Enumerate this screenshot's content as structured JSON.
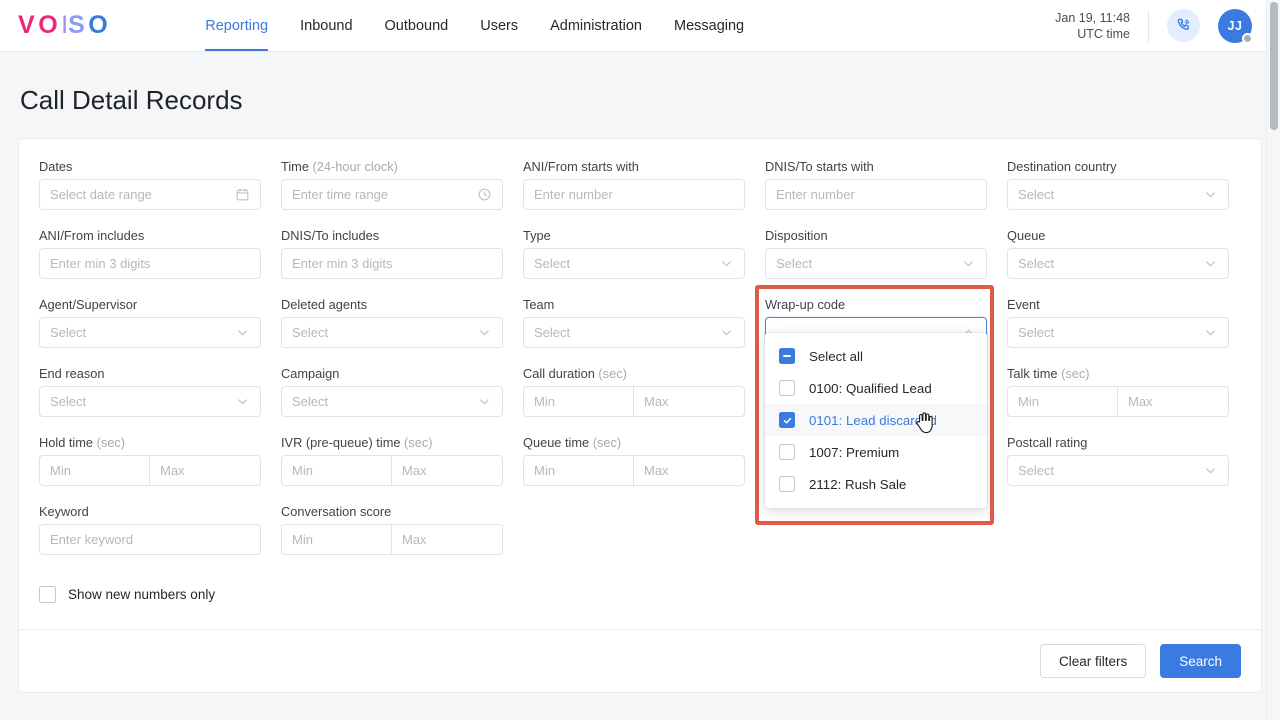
{
  "brand": {
    "logo_letters": [
      "V",
      "O",
      "I",
      "S",
      "O"
    ],
    "accent_blue": "#3b7ae0",
    "accent_pink": "#f0247a",
    "annotation_red": "#e05a47"
  },
  "topnav": {
    "items": [
      {
        "label": "Reporting",
        "active": true
      },
      {
        "label": "Inbound",
        "active": false
      },
      {
        "label": "Outbound",
        "active": false
      },
      {
        "label": "Users",
        "active": false
      },
      {
        "label": "Administration",
        "active": false
      },
      {
        "label": "Messaging",
        "active": false
      }
    ],
    "clock_date": "Jan 19, 11:48",
    "clock_zone": "UTC time",
    "phone_icon": "phone-call-icon",
    "avatar_initials": "JJ",
    "avatar_status": "away"
  },
  "page": {
    "title": "Call Detail Records"
  },
  "filters": {
    "dates": {
      "label": "Dates",
      "placeholder": "Select date range",
      "icon": "calendar-icon"
    },
    "time": {
      "label": "Time",
      "hint": "(24-hour clock)",
      "placeholder": "Enter time range",
      "icon": "clock-icon"
    },
    "ani_starts": {
      "label": "ANI/From starts with",
      "placeholder": "Enter number"
    },
    "dnis_starts": {
      "label": "DNIS/To starts with",
      "placeholder": "Enter number"
    },
    "dest_country": {
      "label": "Destination country",
      "placeholder": "Select"
    },
    "ani_includes": {
      "label": "ANI/From includes",
      "placeholder": "Enter min 3 digits"
    },
    "dnis_includes": {
      "label": "DNIS/To includes",
      "placeholder": "Enter min 3 digits"
    },
    "type": {
      "label": "Type",
      "placeholder": "Select"
    },
    "disposition": {
      "label": "Disposition",
      "placeholder": "Select"
    },
    "queue": {
      "label": "Queue",
      "placeholder": "Select"
    },
    "agent": {
      "label": "Agent/Supervisor",
      "placeholder": "Select"
    },
    "deleted_agents": {
      "label": "Deleted agents",
      "placeholder": "Select"
    },
    "team": {
      "label": "Team",
      "placeholder": "Select"
    },
    "wrapup": {
      "label": "Wrap-up code",
      "value": ""
    },
    "event": {
      "label": "Event",
      "placeholder": "Select"
    },
    "end_reason": {
      "label": "End reason",
      "placeholder": "Select"
    },
    "campaign": {
      "label": "Campaign",
      "placeholder": "Select"
    },
    "call_duration": {
      "label": "Call duration",
      "hint": "(sec)",
      "min_placeholder": "Min",
      "max_placeholder": "Max"
    },
    "talk_time": {
      "label": "Talk time",
      "hint": "(sec)",
      "min_placeholder": "Min",
      "max_placeholder": "Max"
    },
    "hold_time": {
      "label": "Hold time",
      "hint": "(sec)",
      "min_placeholder": "Min",
      "max_placeholder": "Max"
    },
    "ivr_time": {
      "label": "IVR (pre-queue) time",
      "hint": "(sec)",
      "min_placeholder": "Min",
      "max_placeholder": "Max"
    },
    "queue_time": {
      "label": "Queue time",
      "hint": "(sec)",
      "min_placeholder": "Min",
      "max_placeholder": "Max"
    },
    "postcall": {
      "label": "Postcall rating",
      "placeholder": "Select"
    },
    "keyword": {
      "label": "Keyword",
      "placeholder": "Enter keyword"
    },
    "conv_score": {
      "label": "Conversation score",
      "min_placeholder": "Min",
      "max_placeholder": "Max"
    },
    "show_new_numbers": {
      "label": "Show new numbers only",
      "checked": false
    }
  },
  "wrapup_dropdown": {
    "open": true,
    "chevron": "chevron-up-icon",
    "options": [
      {
        "label": "Select all",
        "state": "indeterminate",
        "highlighted": false
      },
      {
        "label": "0100: Qualified Lead",
        "state": "unchecked",
        "highlighted": false
      },
      {
        "label": "0101: Lead discarded",
        "state": "checked",
        "highlighted": true
      },
      {
        "label": "1007: Premium",
        "state": "unchecked",
        "highlighted": false
      },
      {
        "label": "2112: Rush Sale",
        "state": "unchecked",
        "highlighted": false
      }
    ]
  },
  "actions": {
    "clear_label": "Clear filters",
    "search_label": "Search"
  }
}
